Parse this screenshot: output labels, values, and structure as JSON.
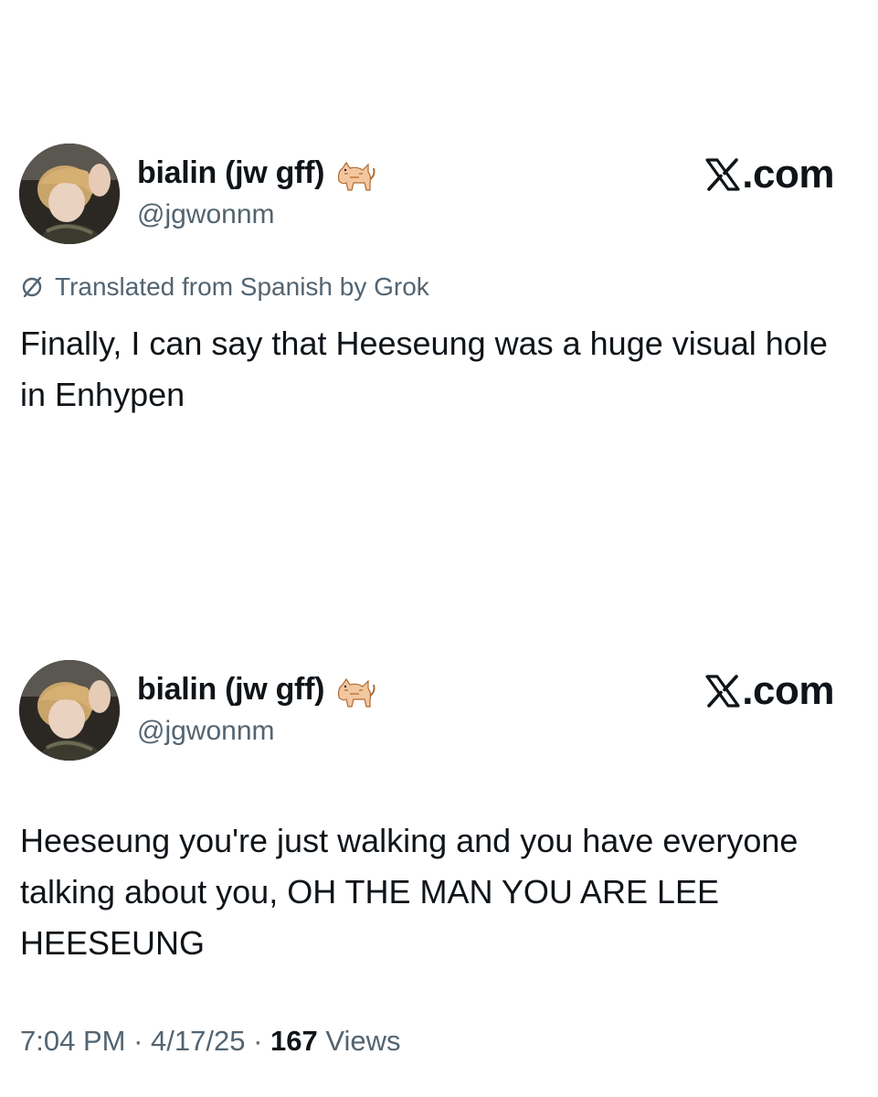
{
  "posts": [
    {
      "display_name": "bialin (jw gff)",
      "name_emoji": "cat-emoji",
      "handle": "@jgwonnm",
      "site": ".com",
      "translation_note": "Translated from Spanish by Grok",
      "text": "Finally, I can say that Heeseung was a huge visual hole in Enhypen"
    },
    {
      "display_name": "bialin (jw gff)",
      "name_emoji": "cat-emoji",
      "handle": "@jgwonnm",
      "site": ".com",
      "text": "Heeseung you're just walking and you have everyone talking about you, OH THE MAN YOU ARE LEE HEESEUNG",
      "time": "7:04 PM",
      "separator": " · ",
      "date": "4/17/25",
      "views_count": "167",
      "views_label": " Views"
    }
  ],
  "colors": {
    "primary_text": "#0f1419",
    "secondary_text": "#536471",
    "background": "#ffffff"
  }
}
